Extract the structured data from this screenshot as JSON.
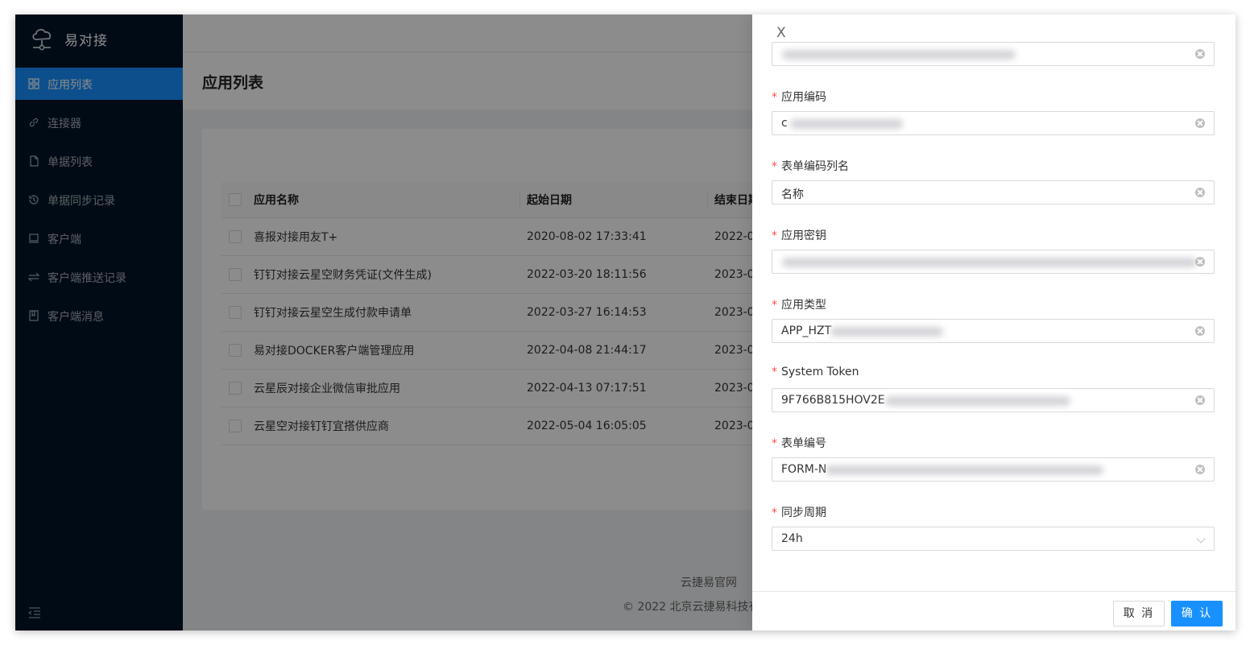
{
  "app": {
    "name": "易对接"
  },
  "sidebar": {
    "items": [
      {
        "label": "应用列表",
        "icon": "grid-icon",
        "active": true
      },
      {
        "label": "连接器",
        "icon": "link-icon",
        "active": false
      },
      {
        "label": "单据列表",
        "icon": "file-icon",
        "active": false
      },
      {
        "label": "单据同步记录",
        "icon": "history-icon",
        "active": false
      },
      {
        "label": "客户端",
        "icon": "laptop-icon",
        "active": false
      },
      {
        "label": "客户端推送记录",
        "icon": "swap-icon",
        "active": false
      },
      {
        "label": "客户端消息",
        "icon": "book-icon",
        "active": false
      }
    ]
  },
  "page": {
    "title": "应用列表"
  },
  "table": {
    "columns": [
      "应用名称",
      "起始日期",
      "结束日期"
    ],
    "rows": [
      {
        "name": "喜报对接用友T+",
        "start": "2020-08-02 17:33:41",
        "end": "2022-0"
      },
      {
        "name": "钉钉对接云星空财务凭证(文件生成)",
        "start": "2022-03-20 18:11:56",
        "end": "2023-0"
      },
      {
        "name": "钉钉对接云星空生成付款申请单",
        "start": "2022-03-27 16:14:53",
        "end": "2023-0"
      },
      {
        "name": "易对接DOCKER客户端管理应用",
        "start": "2022-04-08 21:44:17",
        "end": "2023-0"
      },
      {
        "name": "云星辰对接企业微信审批应用",
        "start": "2022-04-13 07:17:51",
        "end": "2023-0"
      },
      {
        "name": "云星空对接钉钉宜搭供应商",
        "start": "2022-05-04 16:05:05",
        "end": "2023-0"
      }
    ]
  },
  "footer": {
    "link": "云捷易官网",
    "copyright": "© 2022 北京云捷易科技有"
  },
  "drawer": {
    "close": "X",
    "fields": [
      {
        "label": "",
        "value": "",
        "required": false
      },
      {
        "label": "应用编码",
        "value": "c",
        "required": true
      },
      {
        "label": "表单编码列名",
        "value": "名称",
        "required": true
      },
      {
        "label": "应用密钥",
        "value": "",
        "required": true
      },
      {
        "label": "应用类型",
        "value": "APP_HZT",
        "required": true
      },
      {
        "label": "System Token",
        "value": "9F766B815HOV2E",
        "required": true
      },
      {
        "label": "表单编号",
        "value": "FORM-N",
        "required": true
      },
      {
        "label": "同步周期",
        "value": "24h",
        "required": true
      }
    ],
    "cancel": "取 消",
    "ok": "确 认"
  },
  "colors": {
    "sidebar_bg": "#001529",
    "active": "#1890ff",
    "required": "#ff4d4f"
  }
}
